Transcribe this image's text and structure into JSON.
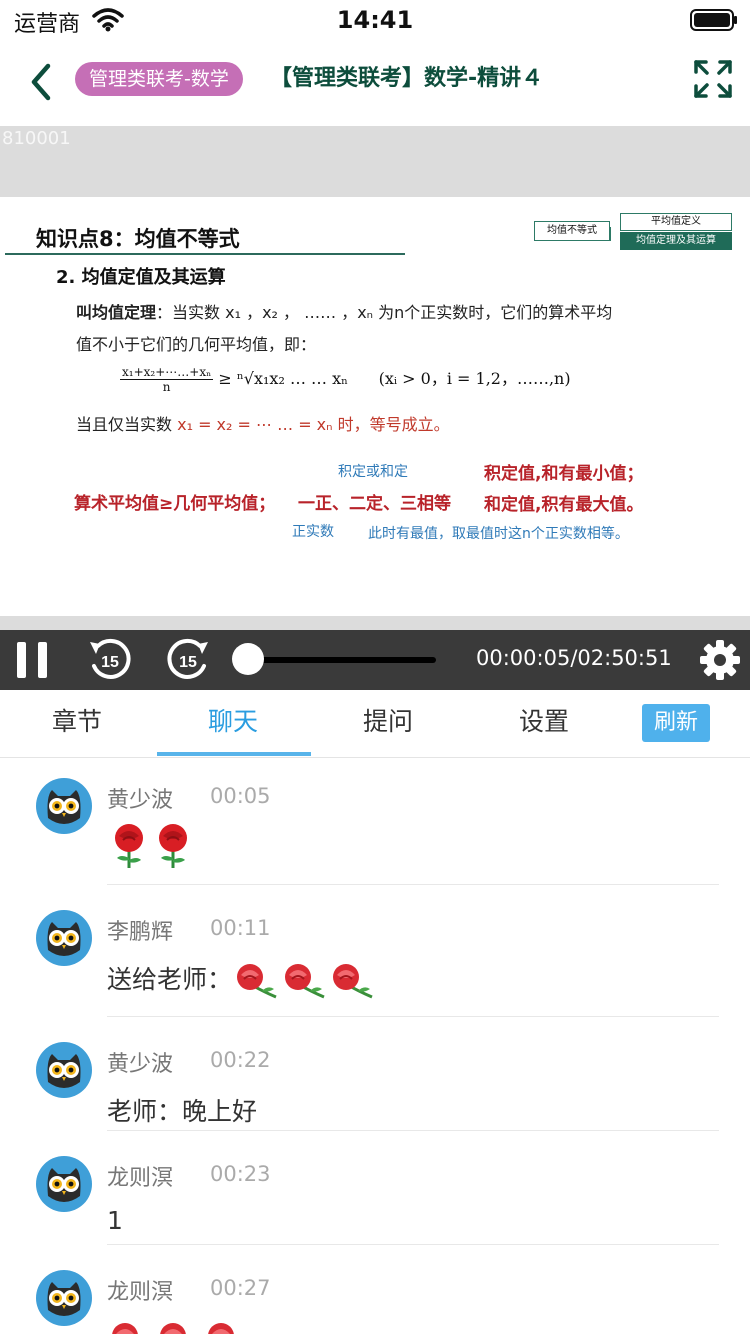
{
  "status_bar": {
    "carrier": "运营商",
    "time": "14:41"
  },
  "header": {
    "course_tag": "管理类联考-数学",
    "title": "【管理类联考】数学-精讲４"
  },
  "video": {
    "id": "810001",
    "slide": {
      "heading": "知识点8：均值不等式",
      "mind_left": "均值不等式",
      "mind_right_1": "平均值定义",
      "mind_right_2": "均值定理及其运算",
      "subheading": "2.  均值定值及其运算",
      "line1_bold": "叫均值定理",
      "line1_rest": "：当实数 x₁ ，x₂ ， …… ，xₙ 为n个正实数时，它们的算术平均",
      "line2": "值不小于它们的几何平均值，即：",
      "formula_num": "x₁+x₂+⋯…+xₙ",
      "formula_den": "n",
      "formula_rhs": "≥ ⁿ√x₁x₂ … … xₙ",
      "formula_cond": "(xᵢ > 0，i = 1,2，……,n)",
      "line3_prefix": "当且仅当实数 ",
      "line3_red": "x₁ = x₂ = ⋯ … = xₙ",
      "line3_red2": " 时，等号成立。",
      "blue1": "积定或和定",
      "red1": "算术平均值≥几何平均值；",
      "red2": "一正、二定、三相等",
      "red3": "积定值,和有最小值；",
      "red4": "和定值,积有最大值。",
      "blue2": "正实数",
      "blue3": "此时有最值，取最值时这n个正实数相等。"
    }
  },
  "player": {
    "rewind_label": "15",
    "forward_label": "15",
    "time": "00:00:05/02:50:51",
    "progress": 0.0005
  },
  "tabs": {
    "items": [
      "章节",
      "聊天",
      "提问",
      "设置"
    ],
    "active": "聊天",
    "refresh": "刷新"
  },
  "chat": [
    {
      "user": "黄少波",
      "time": "00:05",
      "text": "",
      "roses": 2,
      "rose_style": "big"
    },
    {
      "user": "李鹏辉",
      "time": "00:11",
      "text": "送给老师：",
      "roses": 3,
      "rose_style": "small"
    },
    {
      "user": "黄少波",
      "time": "00:22",
      "text": "老师：晚上好",
      "roses": 0
    },
    {
      "user": "龙则溟",
      "time": "00:23",
      "text": "1",
      "roses": 0
    },
    {
      "user": "龙则溟",
      "time": "00:27",
      "text": "",
      "roses": 3,
      "rose_style": "small"
    }
  ],
  "colors": {
    "accent": "#2a9de0",
    "tag": "#c56fb6",
    "title": "#0d4d3c",
    "controls_bg": "#3a3a3a"
  }
}
